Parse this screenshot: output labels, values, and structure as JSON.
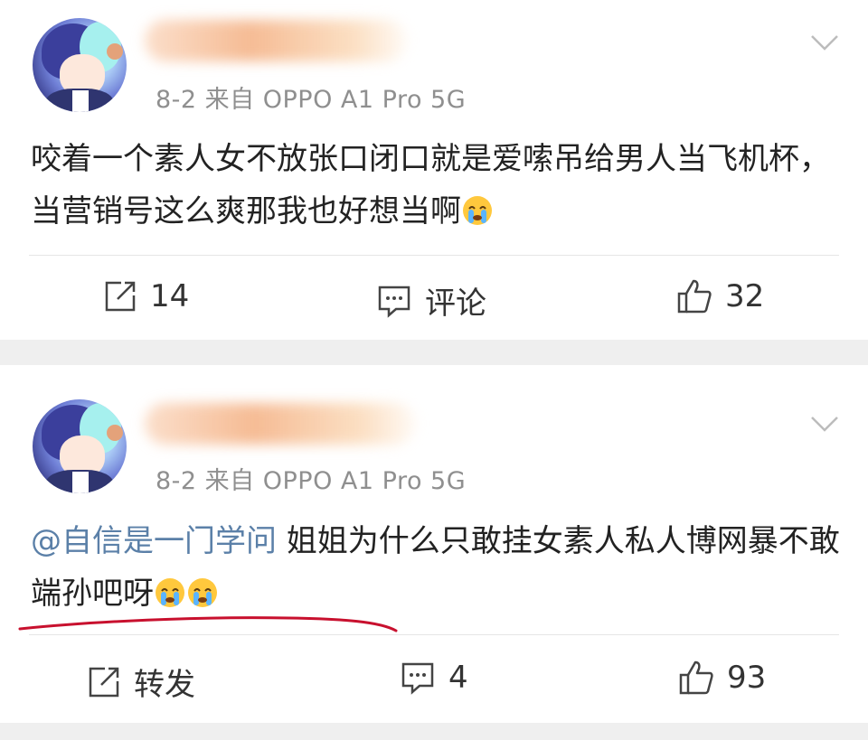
{
  "posts": [
    {
      "meta": "8-2  来自 OPPO A1 Pro 5G",
      "content": "咬着一个素人女不放张口闭口就是爱嗦吊给男人当飞机杯，当营销号这么爽那我也好想当啊",
      "actions": {
        "share": "14",
        "comment": "评论",
        "like": "32"
      },
      "emoji": "crying-face"
    },
    {
      "meta": "8-2  来自 OPPO A1 Pro 5G",
      "mention": "@自信是一门学问",
      "content": " 姐姐为什么只敢挂女素人私人博网暴不敢端孙吧呀",
      "actions": {
        "share": "转发",
        "comment": "4",
        "like": "93"
      },
      "emoji": "crying-face"
    }
  ],
  "colors": {
    "mention": "#5b80a8",
    "meta": "#8f8f8f",
    "underline": "#c8102e",
    "background": "#efefef"
  }
}
